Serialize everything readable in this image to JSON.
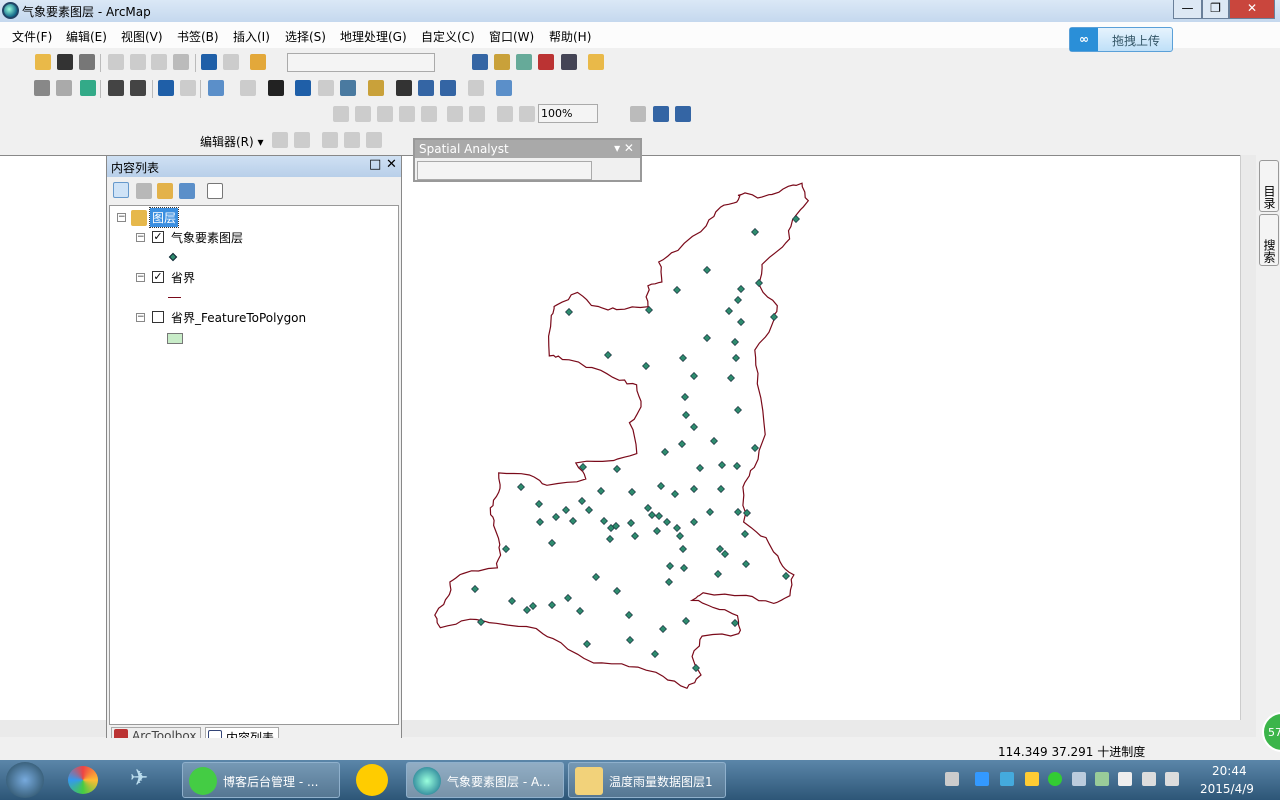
{
  "window": {
    "title": "气象要素图层 - ArcMap",
    "minimize": "—",
    "restore": "❐",
    "close": "✕"
  },
  "menu": [
    "文件(F)",
    "编辑(E)",
    "视图(V)",
    "书签(B)",
    "插入(I)",
    "选择(S)",
    "地理处理(G)",
    "自定义(C)",
    "窗口(W)",
    "帮助(H)"
  ],
  "upload": {
    "label": "拖拽上传"
  },
  "layout_toolbar": {
    "zoom": "100%"
  },
  "editor_toolbar": {
    "label": "编辑器(R) ▾"
  },
  "spatial_analyst": {
    "title": "Spatial Analyst",
    "layer_value": ""
  },
  "toc": {
    "title": "内容列表",
    "root": "图层",
    "layers": [
      {
        "name": "气象要素图层",
        "checked": true,
        "symbol": "point",
        "color": "#2e8b6e"
      },
      {
        "name": "省界",
        "checked": true,
        "symbol": "line",
        "color": "#7a0a1a"
      },
      {
        "name": "省界_FeatureToPolygon",
        "checked": false,
        "symbol": "fill",
        "color": "#c8ecc8"
      }
    ],
    "tabs": [
      "ArcToolbox",
      "内容列表"
    ]
  },
  "side_tabs": [
    "目录",
    "搜索"
  ],
  "status": {
    "coords": "114.349  37.291 十进制度"
  },
  "taskbar": {
    "items": [
      "博客后台管理 - ...",
      "气象要素图层 - A...",
      "温度雨量数据图层1"
    ],
    "time": "20:44",
    "date": "2015/4/9",
    "badge": "57"
  },
  "colors": {
    "boundary": "#7a0a1a",
    "station": "#2e8b6e",
    "accent": "#2a8fd8"
  }
}
